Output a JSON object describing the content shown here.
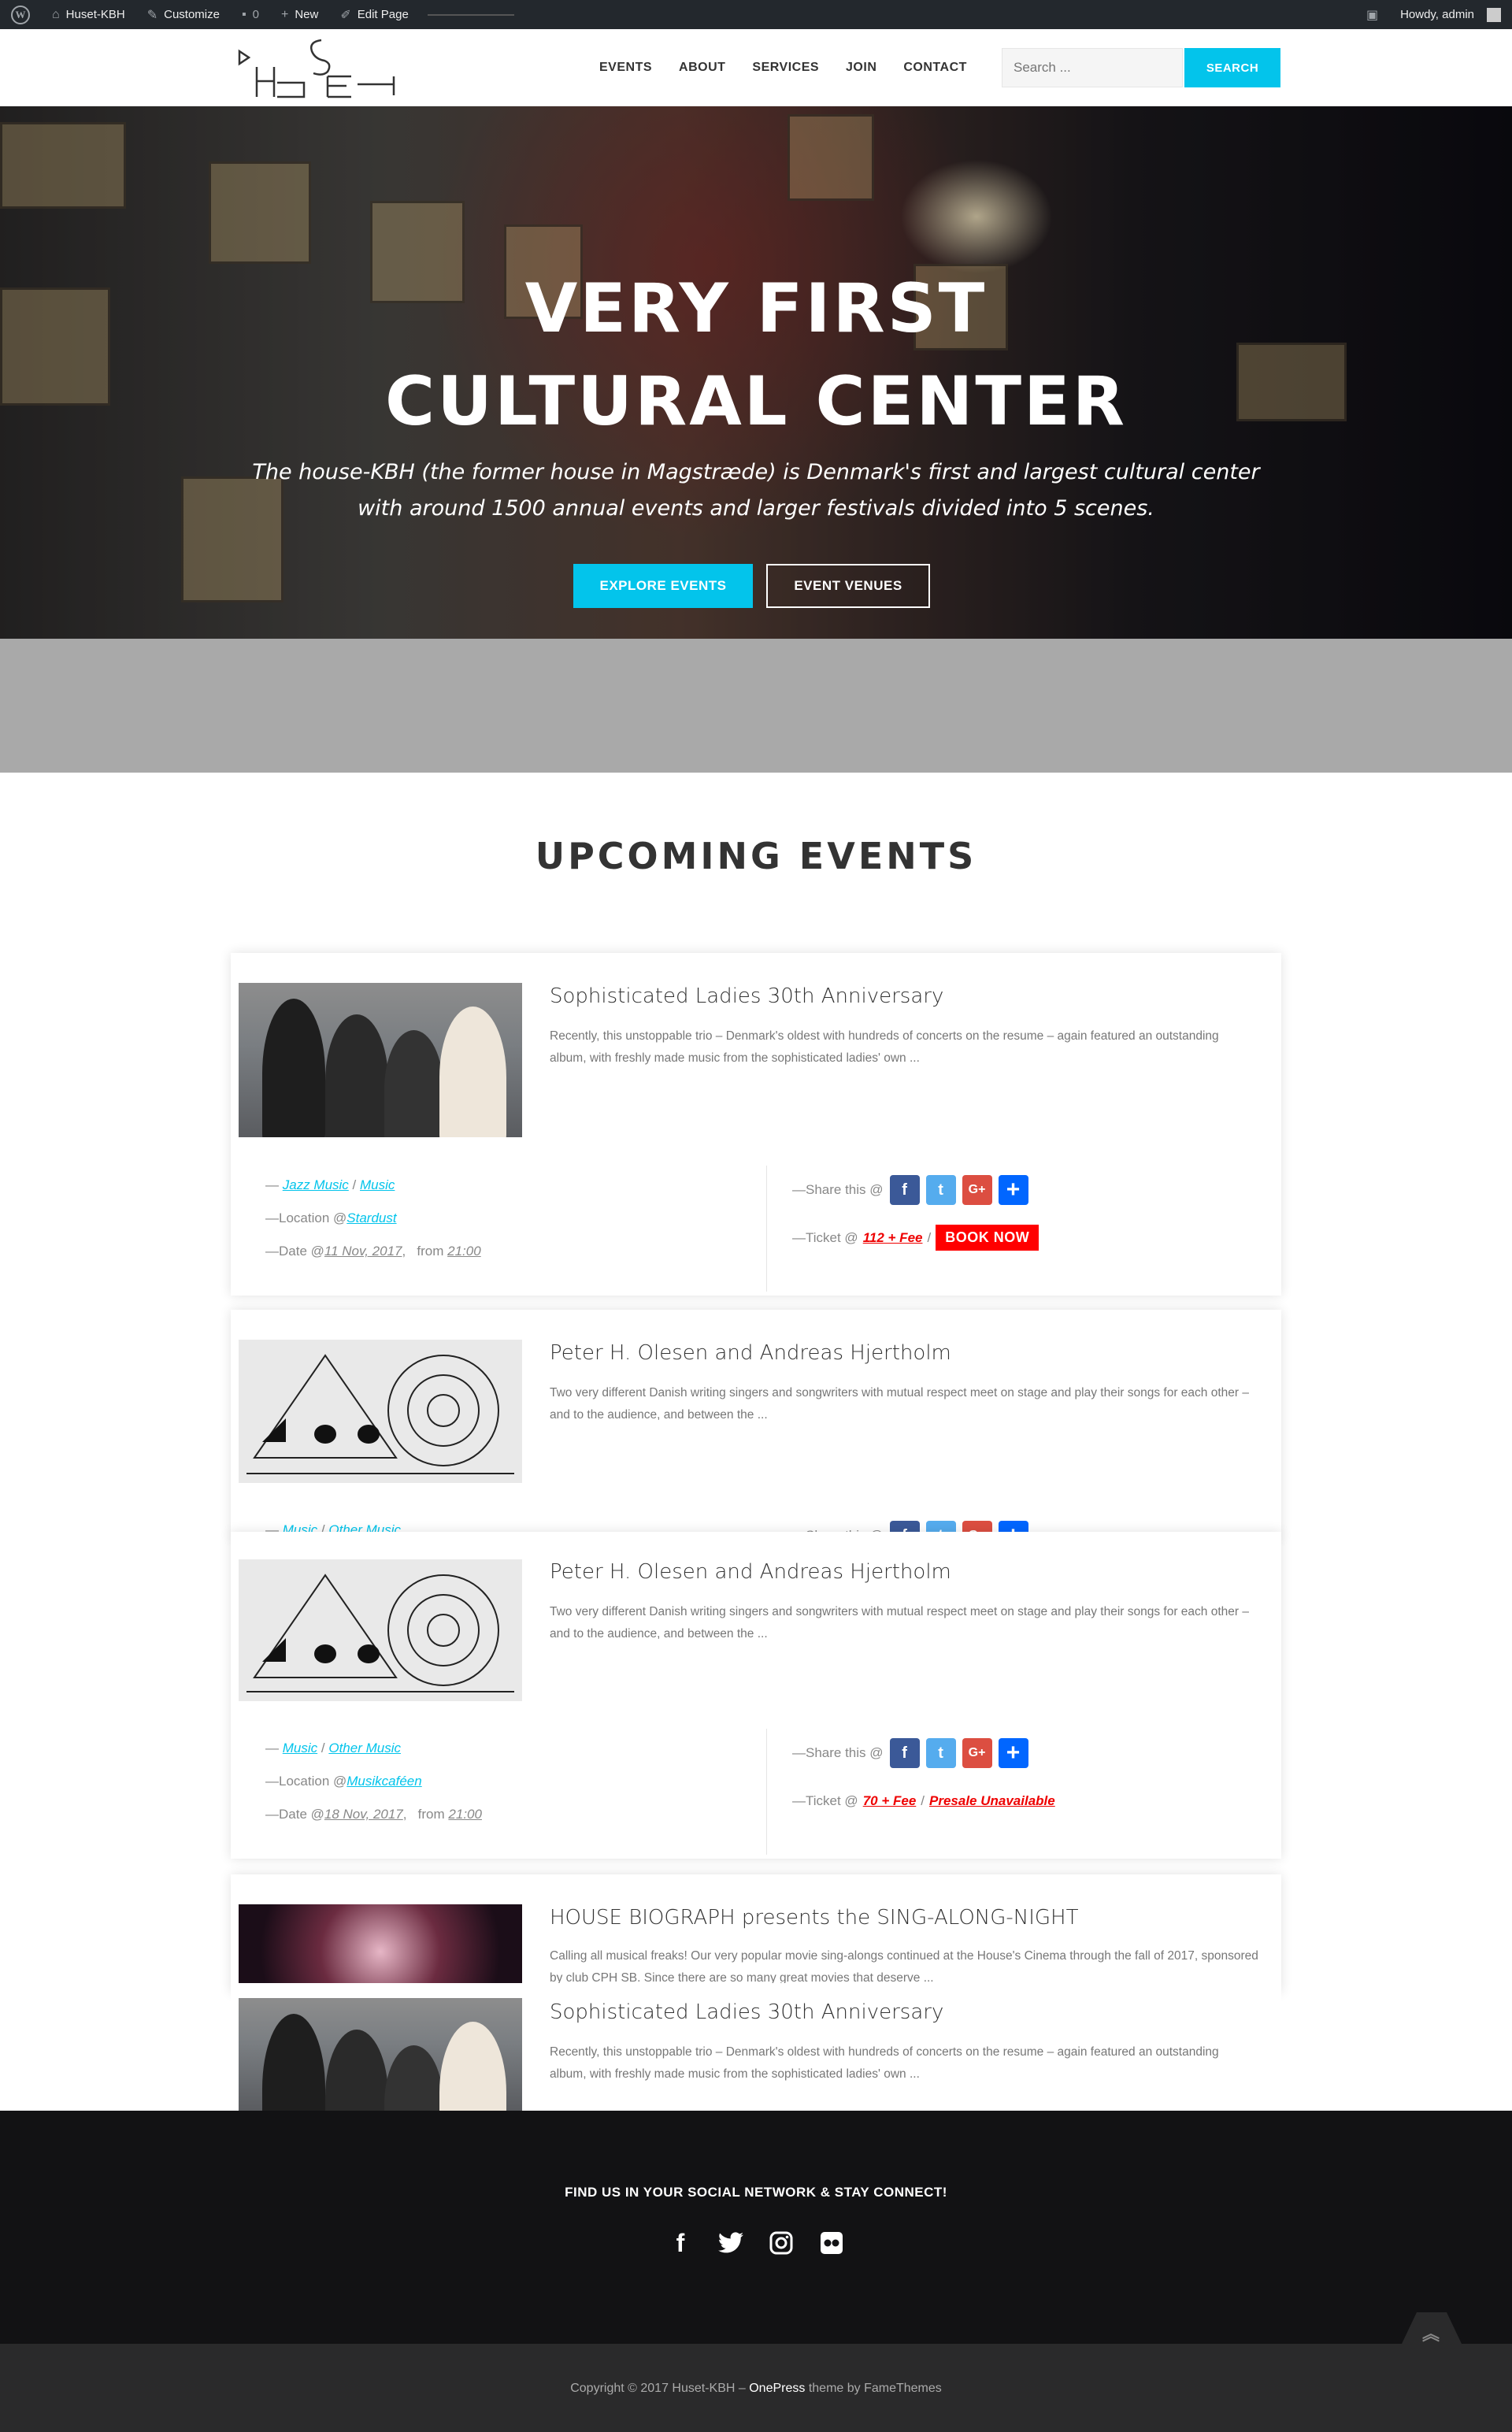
{
  "adminbar": {
    "site_name": "Huset-KBH",
    "customize": "Customize",
    "comments": "0",
    "new": "New",
    "edit_page": "Edit Page",
    "howdy": "Howdy, admin"
  },
  "header": {
    "nav": [
      "EVENTS",
      "ABOUT",
      "SERVICES",
      "JOIN",
      "CONTACT"
    ],
    "search_placeholder": "Search ...",
    "search_button": "SEARCH"
  },
  "hero": {
    "title_line1": "VERY FIRST",
    "title_line2": "CULTURAL CENTER",
    "subtitle": "The house-KBH (the former house in Magstræde) is Denmark's first and largest cultural center with around 1500 annual events and larger festivals divided into 5 scenes.",
    "btn_primary": "EXPLORE EVENTS",
    "btn_secondary": "EVENT VENUES"
  },
  "upcoming_title": "UPCOMING EVENTS",
  "events": [
    {
      "title": "Sophisticated Ladies 30th Anniversary",
      "excerpt": "Recently, this unstoppable trio – Denmark's oldest with hundreds of concerts on the resume – again featured an outstanding album, with freshly made music from the sophisticated ladies' own ...",
      "cat1": "Jazz Music",
      "cat2": "Music",
      "location": "Stardust",
      "date": "11 Nov, 2017",
      "time": "21:00",
      "price": "112 + Fee",
      "ticket_action": "BOOK NOW"
    },
    {
      "title": "Peter H. Olesen and Andreas Hjertholm",
      "excerpt": "Two very different Danish writing singers and songwriters with mutual respect meet on stage and play their songs for each other – and to the audience, and between the ...",
      "cat1": "Music",
      "cat2": "Other Music"
    },
    {
      "title": "Peter H. Olesen and Andreas Hjertholm",
      "excerpt": "Two very different Danish writing singers and songwriters with mutual respect meet on stage and play their songs for each other – and to the audience, and between the ...",
      "cat1": "Music",
      "cat2": "Other Music",
      "location": "Musikcaféen",
      "date": "18 Nov, 2017",
      "time": "21:00",
      "price": "70 + Fee",
      "ticket_action": "Presale Unavailable"
    },
    {
      "title": "HOUSE BIOGRAPH presents the SING-ALONG-NIGHT",
      "excerpt": "Calling all musical freaks! Our very popular movie sing-alongs continued at the House's Cinema through the fall of 2017, sponsored by club CPH SB. Since there are so many great movies that deserve ..."
    },
    {
      "title": "Sophisticated Ladies 30th Anniversary",
      "excerpt": "Recently, this unstoppable trio – Denmark's oldest with hundreds of concerts on the resume – again featured an outstanding album, with freshly made music from the sophisticated ladies' own ..."
    }
  ],
  "labels": {
    "dash": "—",
    "location": "—Location @",
    "date": "—Date @",
    "from": "from",
    "share": "—Share this @",
    "ticket": "—Ticket @",
    "slash": "/"
  },
  "footer": {
    "title": "FIND US IN YOUR SOCIAL NETWORK & STAY CONNECT!",
    "copyright_prefix": "Copyright © 2017 Huset-KBH – ",
    "theme": "OnePress",
    "copyright_suffix": " theme by FameThemes"
  },
  "icons": [
    "wordpress-icon",
    "brush-icon",
    "comment-icon",
    "plus-icon",
    "pencil-icon",
    "facebook-icon",
    "twitter-icon",
    "instagram-icon",
    "flickr-icon",
    "chevron-up-icon"
  ],
  "colors": {
    "accent": "#03c4eb",
    "book": "#ff0000",
    "footer": "#121214"
  }
}
